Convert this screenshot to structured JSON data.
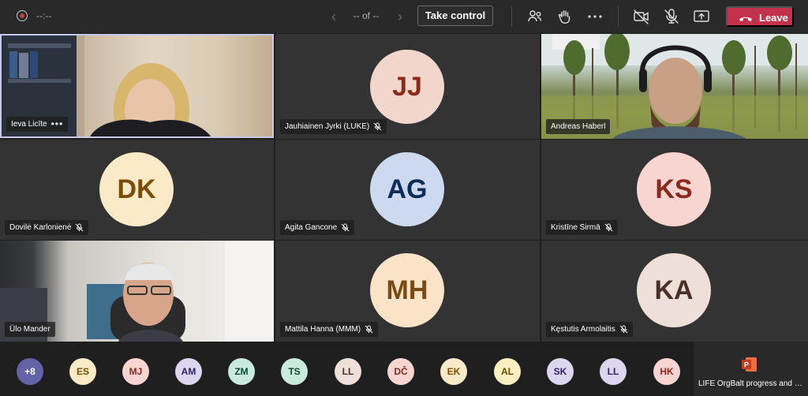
{
  "toolbar": {
    "timer": "--:--",
    "pager_text": "-- of --",
    "take_control_label": "Take control",
    "leave_label": "Leave"
  },
  "tiles": [
    {
      "name": "Ieva Licīte",
      "type": "video"
    },
    {
      "name": "Jauhiainen Jyrki (LUKE)",
      "initials": "JJ",
      "bg": "#f2d6cc",
      "fg": "#8b2a1a"
    },
    {
      "name": "Andreas Haberl",
      "type": "video"
    },
    {
      "name": "Dovilė Karlonienė",
      "initials": "DK",
      "bg": "#faeac7",
      "fg": "#7a4d00"
    },
    {
      "name": "Agita Gancone",
      "initials": "AG",
      "bg": "#ccd9ee",
      "fg": "#0f2c59"
    },
    {
      "name": "Kristīne Sirmā",
      "initials": "KS",
      "bg": "#f8d5d0",
      "fg": "#8a2a1f"
    },
    {
      "name": "Ülo Mander",
      "type": "video"
    },
    {
      "name": "Mattila Hanna (MMM)",
      "initials": "MH",
      "bg": "#fbe3c8",
      "fg": "#7a4a14"
    },
    {
      "name": "Kęstutis Armolaitis",
      "initials": "KA",
      "bg": "#eee0d8",
      "fg": "#4a3028"
    }
  ],
  "roster": [
    {
      "label": "+8",
      "bg": "#6264a7",
      "fg": "#ffffff"
    },
    {
      "label": "ES",
      "bg": "#faeac7",
      "fg": "#7a4d00"
    },
    {
      "label": "MJ",
      "bg": "#f8d5d0",
      "fg": "#8a2a1f"
    },
    {
      "label": "AM",
      "bg": "#dcd7ee",
      "fg": "#2f2463"
    },
    {
      "label": "ZM",
      "bg": "#c9eadc",
      "fg": "#0c4a32"
    },
    {
      "label": "TS",
      "bg": "#c9eadc",
      "fg": "#0c4a32"
    },
    {
      "label": "LL",
      "bg": "#eee0d8",
      "fg": "#4a3028"
    },
    {
      "label": "DČ",
      "bg": "#f8d5d0",
      "fg": "#8a2a1f"
    },
    {
      "label": "EK",
      "bg": "#faeac7",
      "fg": "#7a4d00"
    },
    {
      "label": "AL",
      "bg": "#fbeec0",
      "fg": "#6a4e00"
    },
    {
      "label": "SK",
      "bg": "#dcd7ee",
      "fg": "#2f2463"
    },
    {
      "label": "LL",
      "bg": "#dcd7ee",
      "fg": "#2f2463"
    },
    {
      "label": "HK",
      "bg": "#f8d5d0",
      "fg": "#8a2a1f"
    }
  ],
  "share": {
    "title": "LIFE OrgBalt progress and wh..."
  },
  "icons": {
    "record": "record-icon",
    "prev": "chevron-left-icon",
    "next": "chevron-right-icon",
    "people": "people-icon",
    "raise_hand": "raise-hand-icon",
    "more": "more-icon",
    "camera_off": "camera-off-icon",
    "mic_off": "mic-off-icon",
    "share": "share-screen-icon",
    "phone": "phone-hangup-icon",
    "powerpoint": "powerpoint-icon"
  },
  "colors": {
    "leave": "#c4314b",
    "record": "#d13438",
    "active_border": "#c8c8ee"
  }
}
